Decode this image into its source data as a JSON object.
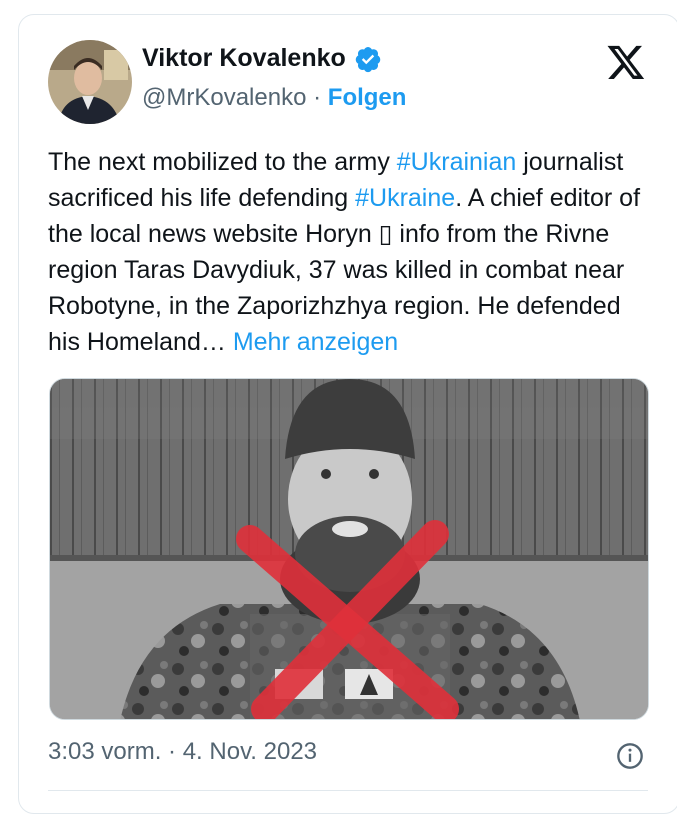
{
  "author": {
    "name": "Viktor Kovalenko",
    "handle": "@MrKovalenko",
    "separator": "·",
    "follow_label": "Folgen",
    "avatar_icon": "profile-photo",
    "verified_icon": "verified-badge-icon"
  },
  "tweet": {
    "segments": [
      {
        "text": "The next mobilized to the army ",
        "type": "text"
      },
      {
        "text": "#Ukrainian",
        "type": "hashtag"
      },
      {
        "text": " journalist sacrificed his life defending ",
        "type": "text"
      },
      {
        "text": "#Ukraine",
        "type": "hashtag"
      },
      {
        "text": ". A chief editor of the local news website Horyn ▯ info from the Rivne region Taras Davydiuk, 37 was killed in combat near Robotyne, in the Zaporizhzhya region. He defended his Homeland… ",
        "type": "text"
      },
      {
        "text": "Mehr anzeigen",
        "type": "more"
      }
    ]
  },
  "footer": {
    "timestamp": "3:03 vorm. · 4. Nov. 2023"
  },
  "colors": {
    "link": "#1d9bf0",
    "text": "#0f1419",
    "muted": "#536471",
    "cross": "#e0303a"
  }
}
